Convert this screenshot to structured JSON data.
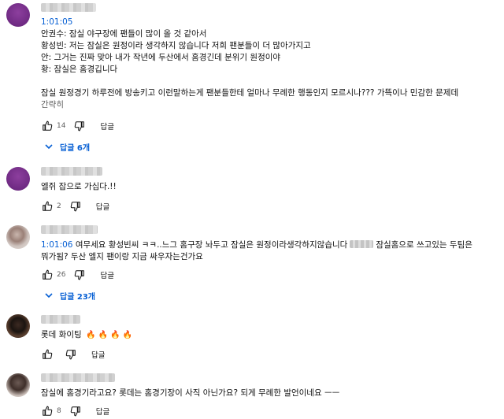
{
  "comments": [
    {
      "timestamp": "1:01:05",
      "lines": [
        "안권수: 잠실 야구장에 팬들이 많이 올 것 같아서",
        "황성빈: 저는 잠실은 원정이라 생각하지 않습니다 저희 팬분들이 더 많아가지고",
        "안: 그거는 진짜 맞아 내가 작년에 두산에서 홈경긴데 분위기 원정이야",
        "황: 잠실은 홈경깁니다",
        "",
        "잠실 원정경기 하루전에 방송키고 이런말하는게 팬분들한테 얼마나 무례한 행동인지 모르시나??? 가뜩이나 민감한 문제데",
        "간략히"
      ],
      "likes": "14",
      "reply_label": "답글",
      "replies_label": "답글 6개"
    },
    {
      "text": "엘쥐 잡으로 가십다.!!",
      "likes": "2",
      "reply_label": "답글"
    },
    {
      "timestamp": "1:01:06",
      "line1_main": " 여무세요 황성빈씨 ㅋㅋ..느그 홈구장 놔두고 잠실은 원정이라생각하지않습니다",
      "line1_tail": "잠실홈으로 쓰고있는 두팀은",
      "line2": "뭐가됨? 두산 엘지 팬이랑 지금 싸우자는건가요",
      "likes": "26",
      "reply_label": "답글",
      "replies_label": "답글 23개"
    },
    {
      "text": "롯데 화이팅",
      "emoji": "🔥 🔥 🔥 🔥",
      "reply_label": "답글"
    },
    {
      "text": "잠실에 홈경기라고요?  롯데는 홈경기장이 사직 아닌가요?  되게 무례한 발언이네요 ㅡㅡ",
      "likes": "8",
      "reply_label": "답글"
    }
  ],
  "icons": {
    "like": "thumbs-up-icon",
    "dislike": "thumbs-down-icon",
    "expand": "chevron-down-icon"
  },
  "colors": {
    "link": "#065fd4",
    "text": "#0f0f0f",
    "secondary": "#606060"
  }
}
